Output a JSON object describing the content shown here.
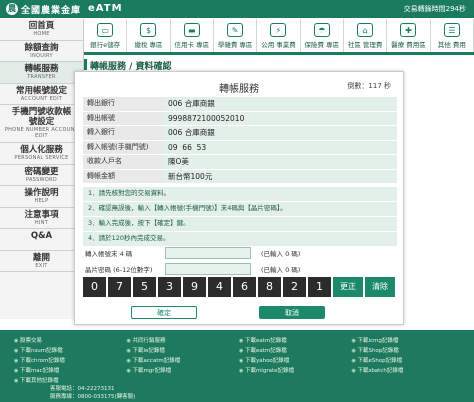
{
  "brand": {
    "bank_name": "全國農業金庫",
    "app_title": "eATM",
    "session": "交易轉錄時間294秒"
  },
  "menu": [
    {
      "label": "銀行e儲存",
      "icon": "bank-card-icon"
    },
    {
      "label": "繳稅 專區",
      "icon": "tax-icon"
    },
    {
      "label": "信用卡 專區",
      "icon": "credit-card-icon"
    },
    {
      "label": "學雜費 專區",
      "icon": "school-icon"
    },
    {
      "label": "公用 事業費",
      "icon": "utility-icon"
    },
    {
      "label": "保險費 專區",
      "icon": "insurance-icon"
    },
    {
      "label": "社區 管理費",
      "icon": "community-icon"
    },
    {
      "label": "醫療 費用區",
      "icon": "medical-icon"
    },
    {
      "label": "其他 費用",
      "icon": "other-fee-icon"
    }
  ],
  "sidebar": [
    {
      "zh": "回首頁",
      "en": "HOME"
    },
    {
      "zh": "餘額查詢",
      "en": "INQUIRY"
    },
    {
      "zh": "轉帳服務",
      "en": "TRANSFER"
    },
    {
      "zh": "常用帳號設定",
      "en": "ACCOUNT EDIT"
    },
    {
      "zh": "手機門號收款帳號設定",
      "en": "PHONE NUMBER ACCOUNT EDIT"
    },
    {
      "zh": "個人化服務",
      "en": "PERSONAL SERVICE"
    },
    {
      "zh": "密碼變更",
      "en": "PASSWORD"
    },
    {
      "zh": "操作說明",
      "en": "HELP"
    },
    {
      "zh": "注意事項",
      "en": "HINT"
    },
    {
      "zh": "Q&A",
      "en": ""
    },
    {
      "zh": "離開",
      "en": "EXIT"
    }
  ],
  "breadcrumb": "轉帳服務 / 資料確認",
  "panel": {
    "title": "轉帳服務",
    "countdown": "倒數：117 秒",
    "rows": [
      {
        "label": "轉出銀行",
        "value": "006 合庫商銀"
      },
      {
        "label": "轉出帳號",
        "value": "9998872100052010"
      },
      {
        "label": "轉入銀行",
        "value": "006 合庫商銀"
      },
      {
        "label": "轉入帳號(手機門號)",
        "value": "09  66  53"
      },
      {
        "label": "收款人戶名",
        "value": "陳O美"
      },
      {
        "label": "轉帳金額",
        "value": "新台幣100元"
      }
    ],
    "notes": [
      "1．請先核對您的交易資料。",
      "2．確認無誤後，輸入【轉入帳號(手機門號)】末4碼與【晶片密碼】。",
      "3．輸入完成後，按下【確定】鍵。",
      "4．請於120秒內完成交易。"
    ],
    "last4_label": "轉入帳號末 4 碼",
    "last4_count": "(已輸入 0 碼)",
    "pin_label": "晶片密碼 (6-12位數字)",
    "pin_count": "(已輸入 0 碼)",
    "keypad": [
      "0",
      "7",
      "5",
      "3",
      "9",
      "4",
      "6",
      "8",
      "2",
      "1"
    ],
    "key_correct": "更正",
    "key_clear": "清除",
    "confirm": "確定",
    "cancel": "取消"
  },
  "footer": {
    "links": [
      "股票交易",
      "共同行銷服務",
      "下載eatm記錄檔",
      "下載icmg記錄檔",
      "下載nsum記錄檔",
      "下載ie記錄檔",
      "下載eatm記錄檔",
      "下載Shop記錄檔",
      "下載chrom記錄檔",
      "下載accatm記錄檔",
      "下載yahoo記錄檔",
      "下載eShop記錄檔",
      "下載mac記錄檔",
      "下載mgr記錄檔",
      "下載migrate記錄檔",
      "下載sbatch記錄檔",
      "下載其他記錄檔"
    ],
    "phone_label": "客服電話：04-22273131",
    "service_label": "服務專線：0800-033175(轉客服)"
  },
  "colors": {
    "brand_green": "#1a7b5e",
    "accent": "#1c8a6a"
  }
}
